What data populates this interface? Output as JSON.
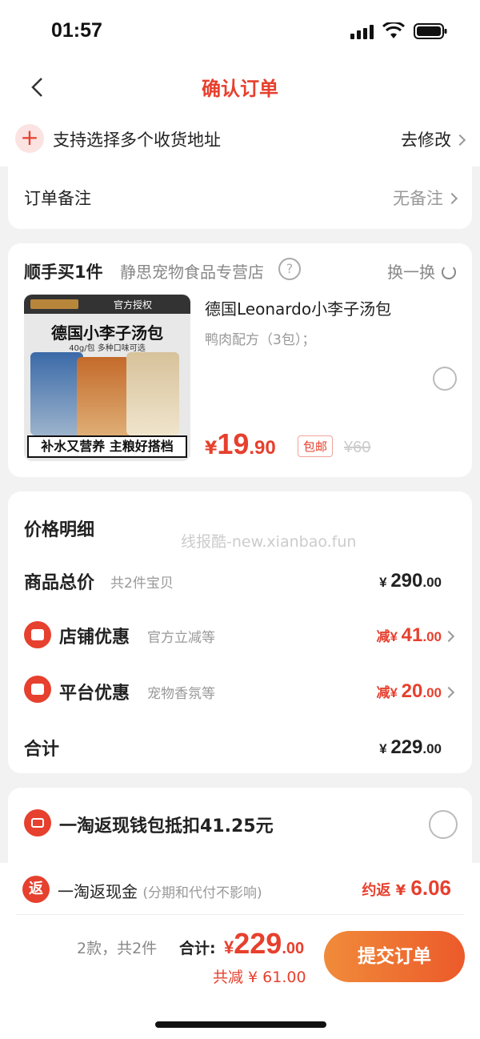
{
  "status": {
    "time": "01:57"
  },
  "nav": {
    "title": "确认订单"
  },
  "address": {
    "plus": "+",
    "text": "支持选择多个收货地址",
    "action": "去修改"
  },
  "remark": {
    "label": "订单备注",
    "value": "无备注"
  },
  "product_card": {
    "title": "顺手买1件",
    "shop": "静思宠物食品专营店",
    "help": "?",
    "swap": "换一换",
    "image": {
      "auth": "官方授权",
      "headline": "德国小李子汤包",
      "subline": "40g/包 多种口味可选",
      "bottom": "补水又营养 主粮好搭档"
    },
    "name": "德国Leonardo小李子汤包",
    "spec": "鸭肉配方（3包）；",
    "price": {
      "symbol": "¥",
      "int": "19",
      "dec": ".90"
    },
    "shipping": "包邮",
    "original": "¥60"
  },
  "price_detail": {
    "title": "价格明细",
    "watermark": "线报酷-new.xianbao.fun",
    "goods": {
      "label": "商品总价",
      "sub": "共2件宝贝",
      "symbol": "¥ ",
      "int": "290",
      "dec": ".00"
    },
    "shop_discount": {
      "label": "店铺优惠",
      "sub": "官方立减等",
      "prefix": "减",
      "symbol": "¥ ",
      "int": "41",
      "dec": ".00"
    },
    "platform_discount": {
      "label": "平台优惠",
      "sub": "宠物香氛等",
      "symbol": "¥ ",
      "prefix": "减",
      "int": "20",
      "dec": ".00"
    },
    "total": {
      "label": "合计",
      "symbol": "¥ ",
      "int": "229",
      "dec": ".00"
    }
  },
  "wallet": {
    "text": "一淘返现钱包抵扣41.25元"
  },
  "cashback": {
    "icon": "返",
    "label": "一淘返现金",
    "note": "(分期和代付不影响)",
    "prefix": "约返 ¥ ",
    "value": "6.06"
  },
  "footer": {
    "count": "2款，共2件",
    "total_label": "合计:",
    "total_symbol": "¥",
    "total_int": "229",
    "total_dec": ".00",
    "discount": "共减 ¥ 61.00",
    "submit": "提交订单"
  },
  "colors": {
    "accent": "#e6402e",
    "button_start": "#f08b3a",
    "button_end": "#ec5a2a"
  }
}
